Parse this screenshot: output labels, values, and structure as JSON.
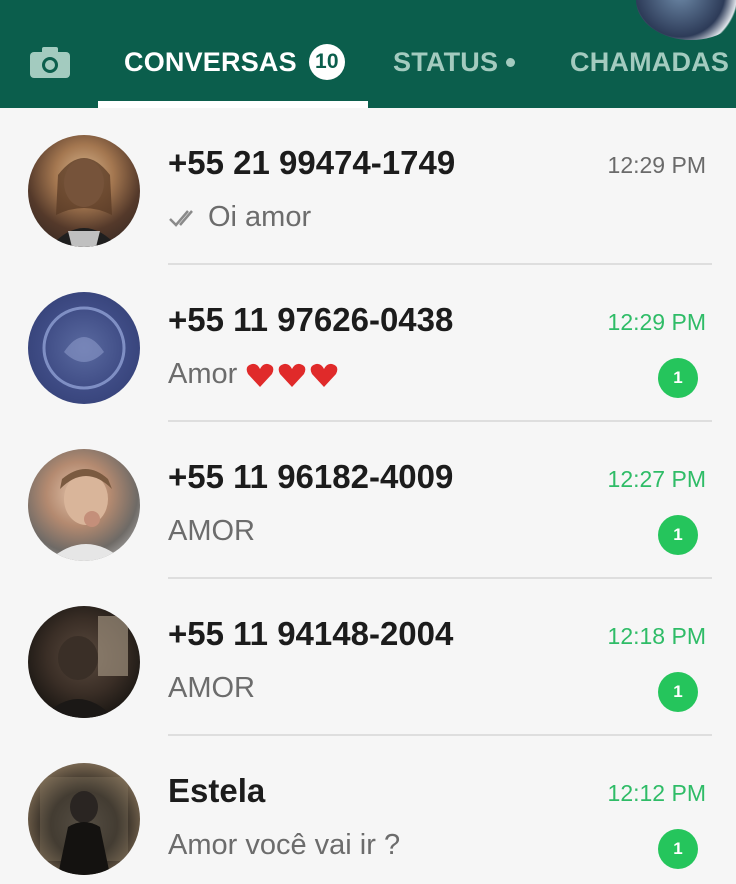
{
  "tabs": {
    "camera_icon": "camera-icon",
    "conversas_label": "CONVERSAS",
    "conversas_badge": "10",
    "status_label": "STATUS",
    "chamadas_label": "CHAMADAS"
  },
  "colors": {
    "header": "#0b5e4c",
    "active_tab": "#ffffff",
    "inactive_tab": "#a3cbbf",
    "unread_green": "#25c55c"
  },
  "chats": [
    {
      "name": "+55 21 99474-1749",
      "time": "12:29 PM",
      "preview": "Oi amor",
      "read_ticks": true,
      "hearts": 0,
      "unread": ""
    },
    {
      "name": "+55 11 97626-0438",
      "time": "12:29 PM",
      "preview": "Amor",
      "read_ticks": false,
      "hearts": 3,
      "unread": "1"
    },
    {
      "name": "+55 11 96182-4009",
      "time": "12:27 PM",
      "preview": "AMOR",
      "read_ticks": false,
      "hearts": 0,
      "unread": "1"
    },
    {
      "name": "+55 11 94148-2004",
      "time": "12:18 PM",
      "preview": "AMOR",
      "read_ticks": false,
      "hearts": 0,
      "unread": "1"
    },
    {
      "name": "Estela",
      "time": "12:12 PM",
      "preview": "Amor você vai ir ?",
      "read_ticks": false,
      "hearts": 0,
      "unread": "1"
    }
  ]
}
